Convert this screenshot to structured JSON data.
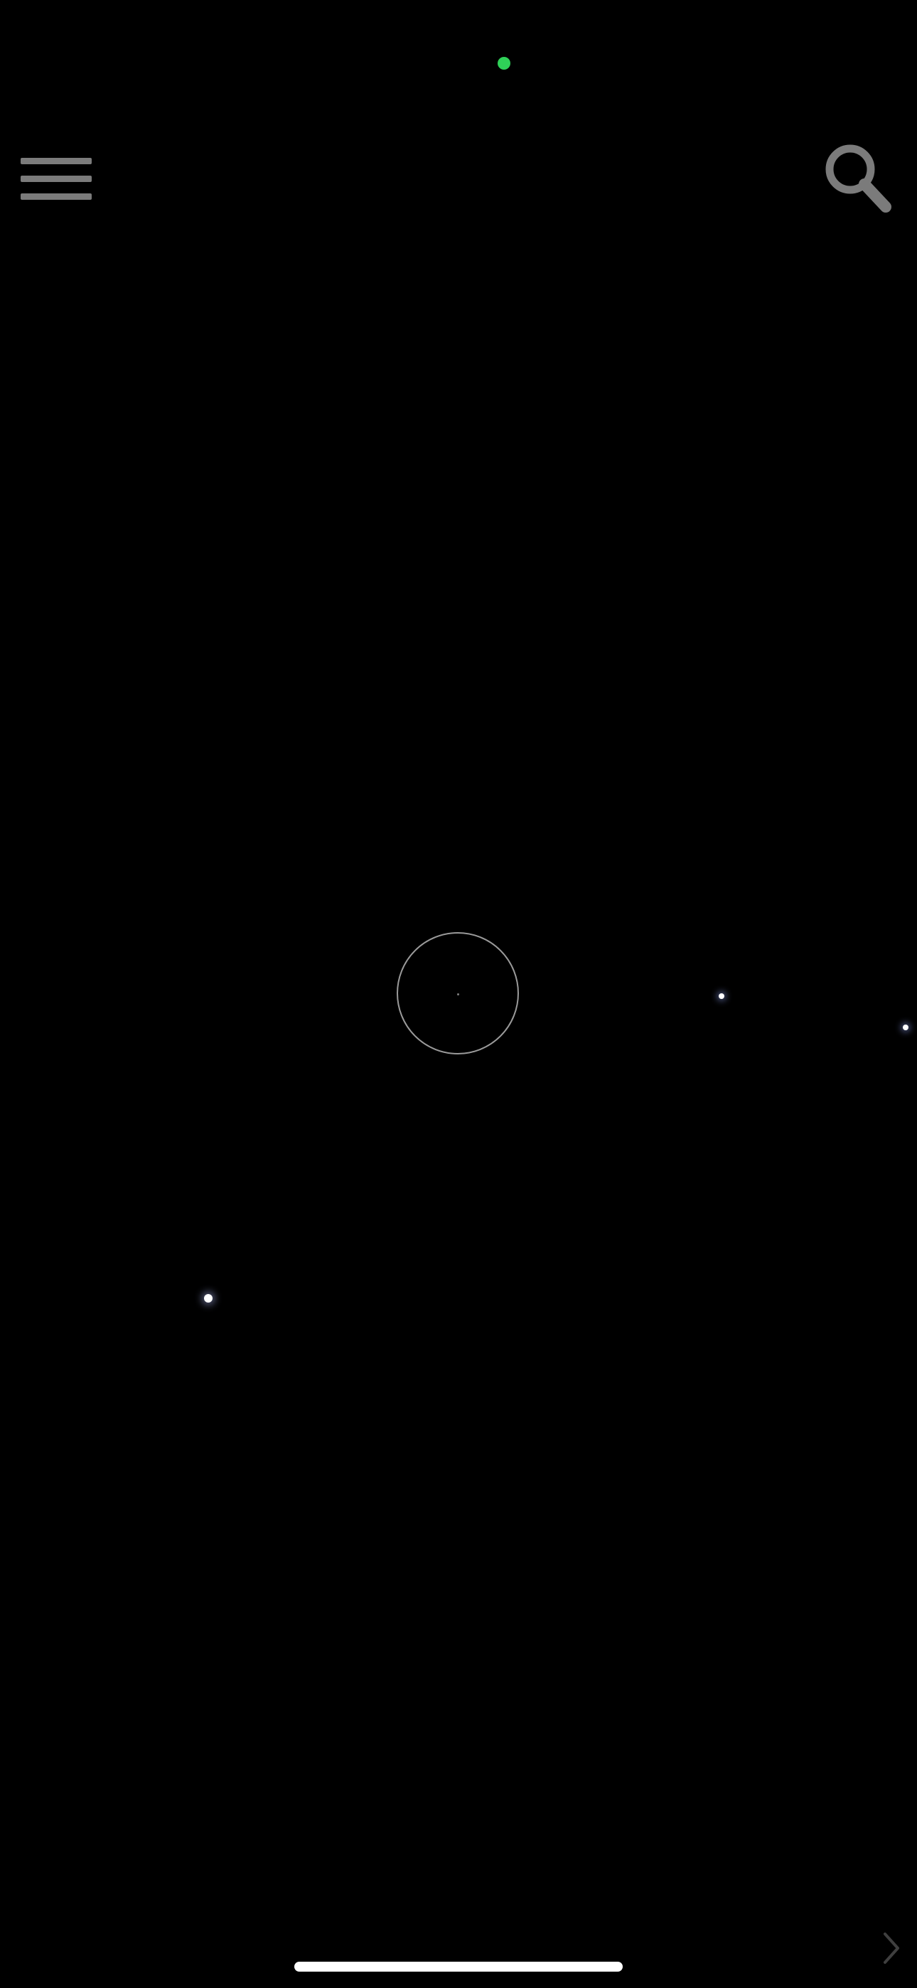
{
  "status_bar": {
    "privacy_indicator_color": "#2fd158"
  },
  "toolbar": {
    "menu_icon": "hamburger-menu-icon",
    "search_icon": "search-icon",
    "icon_color": "#7b7b7b"
  },
  "sky_view": {
    "background_color": "#000000",
    "reticle_color": "#9a9a9a",
    "star_color": "#ffffff",
    "corner_icon": "chevron-right-icon"
  },
  "system_ui": {
    "home_indicator_color": "#ffffff"
  }
}
